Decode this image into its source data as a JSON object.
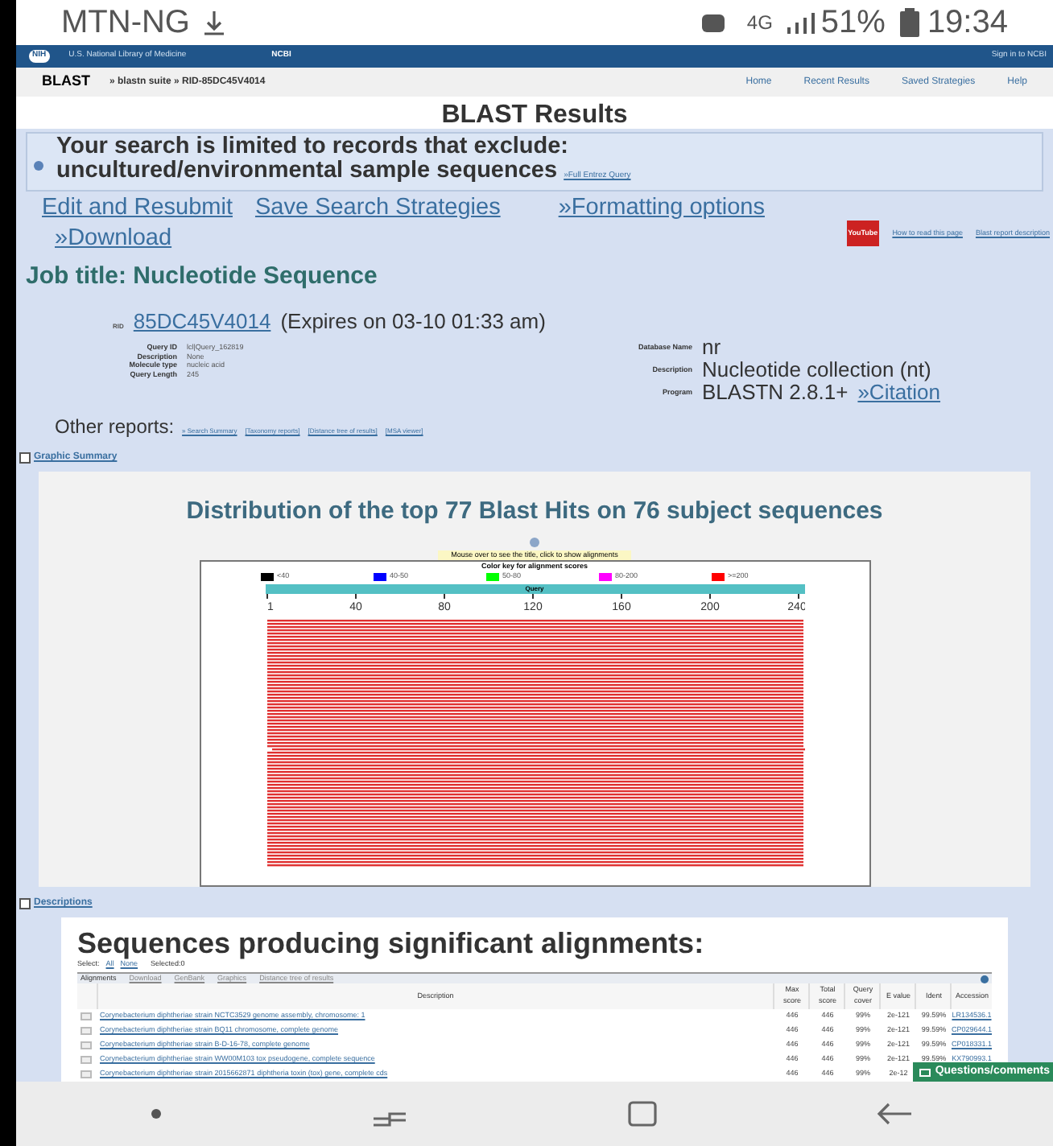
{
  "status_bar": {
    "carrier": "MTN-NG",
    "network": "4G",
    "battery": "51%",
    "time": "19:34"
  },
  "ncbi_bar": {
    "logo": "NIH",
    "library": "U.S. National Library of Medicine",
    "brand": "NCBI",
    "sign_in": "Sign in to NCBI"
  },
  "breadcrumb": {
    "app": "BLAST",
    "trail": "» blastn suite » RID-85DC45V4014",
    "links": [
      "Home",
      "Recent Results",
      "Saved Strategies",
      "Help"
    ]
  },
  "page_title": "BLAST Results",
  "notice": {
    "text": "Your search is limited to records that exclude: uncultured/environmental sample sequences",
    "link": "»Full Entrez Query"
  },
  "actions": [
    {
      "label": "Edit and Resubmit"
    },
    {
      "label": "Save Search Strategies"
    },
    {
      "label": "»Formatting options"
    },
    {
      "label": "»Download"
    }
  ],
  "help_links": [
    "How to read this page",
    "Blast report description"
  ],
  "youtube_badge": "YouTube",
  "job_title": "Job title: Nucleotide Sequence",
  "rid": {
    "label": "RID",
    "value": "85DC45V4014",
    "expires": "(Expires on 03-10 01:33 am)"
  },
  "query_info": [
    {
      "label": "Query ID",
      "value": "lcl|Query_162819"
    },
    {
      "label": "Description",
      "value": "None"
    },
    {
      "label": "Molecule type",
      "value": "nucleic acid"
    },
    {
      "label": "Query Length",
      "value": "245"
    }
  ],
  "database_info": [
    {
      "label": "Database Name",
      "value": "nr"
    },
    {
      "label": "Description",
      "value": "Nucleotide collection (nt)"
    },
    {
      "label": "Program",
      "value": "BLASTN 2.8.1+"
    }
  ],
  "citation": "»Citation",
  "other_reports": {
    "label": "Other reports:",
    "links": [
      "» Search Summary",
      "[Taxonomy reports]",
      "[Distance tree of results]",
      "[MSA viewer]"
    ]
  },
  "graphic_summary": {
    "section": "Graphic Summary",
    "title": "Distribution of the top 77 Blast Hits on 76 subject sequences",
    "hint": "Mouse over to see the title, click to show alignments",
    "key_title": "Color key for alignment scores",
    "key": [
      {
        "label": "<40",
        "color": "#000000"
      },
      {
        "label": "40-50",
        "color": "#0000ff"
      },
      {
        "label": "50-80",
        "color": "#00ff00"
      },
      {
        "label": "80-200",
        "color": "#ff00ff"
      },
      {
        "label": ">=200",
        "color": "#ff0000"
      }
    ],
    "query_label": "Query",
    "ticks": [
      "1",
      "40",
      "80",
      "120",
      "160",
      "200",
      "240"
    ]
  },
  "descriptions": {
    "section": "Descriptions",
    "title": "Sequences producing significant alignments:",
    "select_label": "Select:",
    "select_links": [
      "All",
      "None"
    ],
    "selected": "Selected:0",
    "toolbar": [
      "Alignments",
      "Download",
      "GenBank",
      "Graphics",
      "Distance tree of results"
    ],
    "columns": [
      "Description",
      "Max score",
      "Total score",
      "Query cover",
      "E value",
      "Ident",
      "Accession"
    ],
    "rows": [
      {
        "selected": false,
        "cells": [
          "Corynebacterium diphtheriae strain NCTC3529 genome assembly, chromosome: 1",
          "446",
          "446",
          "99%",
          "2e-121",
          "99.59%",
          "LR134536.1"
        ]
      },
      {
        "selected": false,
        "cells": [
          "Corynebacterium diphtheriae strain BQ11 chromosome, complete genome",
          "446",
          "446",
          "99%",
          "2e-121",
          "99.59%",
          "CP029644.1"
        ]
      },
      {
        "selected": false,
        "cells": [
          "Corynebacterium diphtheriae strain B-D-16-78, complete genome",
          "446",
          "446",
          "99%",
          "2e-121",
          "99.59%",
          "CP018331.1"
        ]
      },
      {
        "selected": false,
        "cells": [
          "Corynebacterium diphtheriae strain WW00M103 tox pseudogene, complete sequence",
          "446",
          "446",
          "99%",
          "2e-121",
          "99.59%",
          "KX790993.1"
        ]
      },
      {
        "selected": false,
        "cells": [
          "Corynebacterium diphtheriae strain 2015662871 diphtheria toxin (tox) gene, complete cds",
          "446",
          "446",
          "99%",
          "2e-12"
        ]
      }
    ]
  },
  "feedback_button": "Questions/comments"
}
